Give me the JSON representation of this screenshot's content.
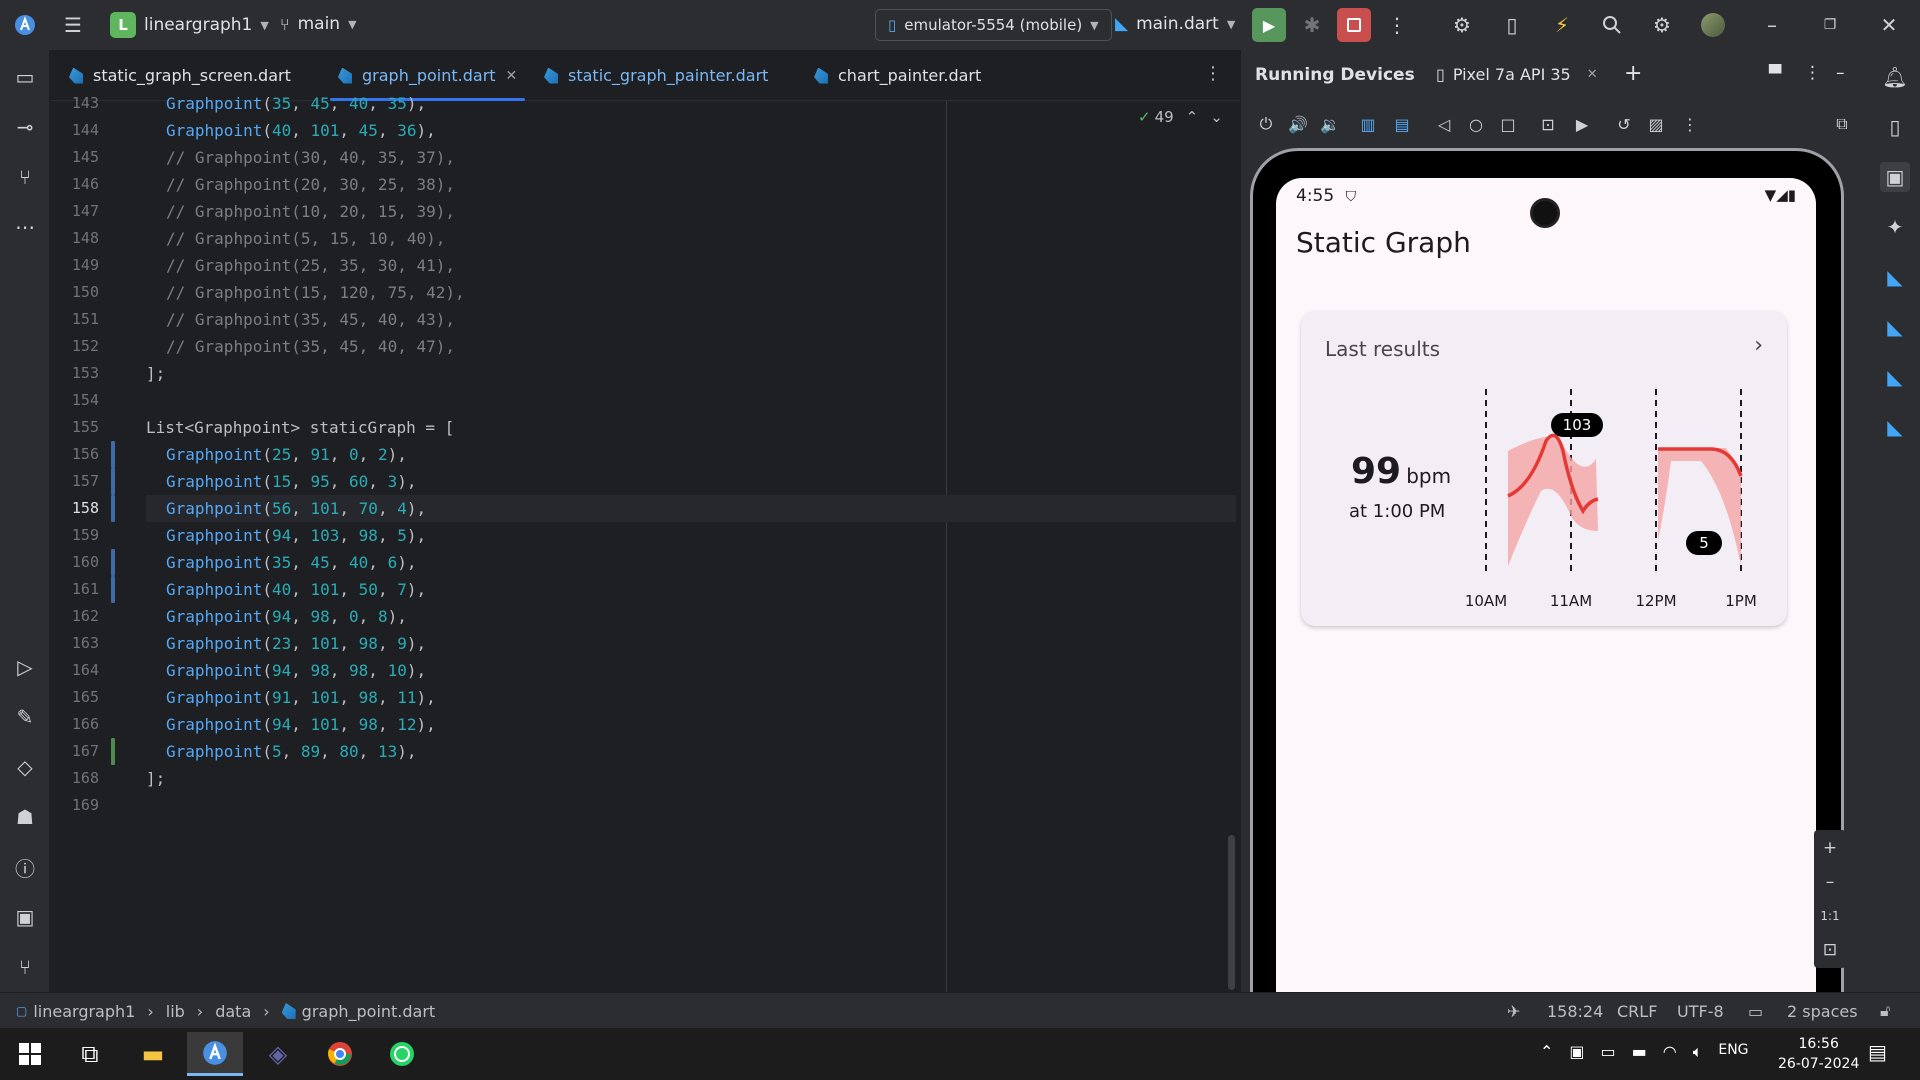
{
  "titlebar": {
    "project": "lineargraph1",
    "project_initial": "L",
    "branch": "main",
    "device": "emulator-5554 (mobile)",
    "run_config": "main.dart"
  },
  "tabs": [
    {
      "label": "static_graph_screen.dart",
      "active": false
    },
    {
      "label": "graph_point.dart",
      "active": true
    },
    {
      "label": "static_graph_painter.dart",
      "active": false
    },
    {
      "label": "chart_painter.dart",
      "active": false
    }
  ],
  "editor": {
    "inspection_count": "49",
    "lines": [
      {
        "n": "143",
        "code": [
          [
            "fn",
            "Graphpoint"
          ],
          [
            "pun",
            "("
          ],
          [
            "num",
            "35"
          ],
          [
            "pun",
            ", "
          ],
          [
            "num",
            "45"
          ],
          [
            "pun",
            ", "
          ],
          [
            "num",
            "40"
          ],
          [
            "pun",
            ", "
          ],
          [
            "num",
            "35"
          ],
          [
            "pun",
            "),"
          ]
        ]
      },
      {
        "n": "144",
        "code": [
          [
            "fn",
            "Graphpoint"
          ],
          [
            "pun",
            "("
          ],
          [
            "num",
            "40"
          ],
          [
            "pun",
            ", "
          ],
          [
            "num",
            "101"
          ],
          [
            "pun",
            ", "
          ],
          [
            "num",
            "45"
          ],
          [
            "pun",
            ", "
          ],
          [
            "num",
            "36"
          ],
          [
            "pun",
            "),"
          ]
        ]
      },
      {
        "n": "145",
        "comment": "Graphpoint(30, 40, 35, 37),"
      },
      {
        "n": "146",
        "comment": "Graphpoint(20, 30, 25, 38),"
      },
      {
        "n": "147",
        "comment": "Graphpoint(10, 20, 15, 39),"
      },
      {
        "n": "148",
        "comment": "Graphpoint(5, 15, 10, 40),"
      },
      {
        "n": "149",
        "comment": "Graphpoint(25, 35, 30, 41),"
      },
      {
        "n": "150",
        "comment": "Graphpoint(15, 120, 75, 42),"
      },
      {
        "n": "151",
        "comment": "Graphpoint(35, 45, 40, 43),"
      },
      {
        "n": "152",
        "comment": "Graphpoint(35, 45, 40, 47),"
      },
      {
        "n": "153",
        "plain": "];"
      },
      {
        "n": "154",
        "plain": ""
      },
      {
        "n": "155",
        "plain": "List<Graphpoint> staticGraph = ["
      },
      {
        "n": "156",
        "code": [
          [
            "fn",
            "Graphpoint"
          ],
          [
            "pun",
            "("
          ],
          [
            "num",
            "25"
          ],
          [
            "pun",
            ", "
          ],
          [
            "num",
            "91"
          ],
          [
            "pun",
            ", "
          ],
          [
            "num",
            "0"
          ],
          [
            "pun",
            ", "
          ],
          [
            "num",
            "2"
          ],
          [
            "pun",
            "),"
          ]
        ]
      },
      {
        "n": "157",
        "code": [
          [
            "fn",
            "Graphpoint"
          ],
          [
            "pun",
            "("
          ],
          [
            "num",
            "15"
          ],
          [
            "pun",
            ", "
          ],
          [
            "num",
            "95"
          ],
          [
            "pun",
            ", "
          ],
          [
            "num",
            "60"
          ],
          [
            "pun",
            ", "
          ],
          [
            "num",
            "3"
          ],
          [
            "pun",
            "),"
          ]
        ]
      },
      {
        "n": "158",
        "code": [
          [
            "fn",
            "Graphpoint"
          ],
          [
            "pun",
            "("
          ],
          [
            "num",
            "56"
          ],
          [
            "pun",
            ", "
          ],
          [
            "num",
            "101"
          ],
          [
            "pun",
            ", "
          ],
          [
            "num",
            "70"
          ],
          [
            "pun",
            ", "
          ],
          [
            "num",
            "4"
          ],
          [
            "pun",
            "),"
          ]
        ]
      },
      {
        "n": "159",
        "code": [
          [
            "fn",
            "Graphpoint"
          ],
          [
            "pun",
            "("
          ],
          [
            "num",
            "94"
          ],
          [
            "pun",
            ", "
          ],
          [
            "num",
            "103"
          ],
          [
            "pun",
            ", "
          ],
          [
            "num",
            "98"
          ],
          [
            "pun",
            ", "
          ],
          [
            "num",
            "5"
          ],
          [
            "pun",
            "),"
          ]
        ]
      },
      {
        "n": "160",
        "code": [
          [
            "fn",
            "Graphpoint"
          ],
          [
            "pun",
            "("
          ],
          [
            "num",
            "35"
          ],
          [
            "pun",
            ", "
          ],
          [
            "num",
            "45"
          ],
          [
            "pun",
            ", "
          ],
          [
            "num",
            "40"
          ],
          [
            "pun",
            ", "
          ],
          [
            "num",
            "6"
          ],
          [
            "pun",
            "),"
          ]
        ]
      },
      {
        "n": "161",
        "code": [
          [
            "fn",
            "Graphpoint"
          ],
          [
            "pun",
            "("
          ],
          [
            "num",
            "40"
          ],
          [
            "pun",
            ", "
          ],
          [
            "num",
            "101"
          ],
          [
            "pun",
            ", "
          ],
          [
            "num",
            "50"
          ],
          [
            "pun",
            ", "
          ],
          [
            "num",
            "7"
          ],
          [
            "pun",
            "),"
          ]
        ]
      },
      {
        "n": "162",
        "code": [
          [
            "fn",
            "Graphpoint"
          ],
          [
            "pun",
            "("
          ],
          [
            "num",
            "94"
          ],
          [
            "pun",
            ", "
          ],
          [
            "num",
            "98"
          ],
          [
            "pun",
            ", "
          ],
          [
            "num",
            "0"
          ],
          [
            "pun",
            ", "
          ],
          [
            "num",
            "8"
          ],
          [
            "pun",
            "),"
          ]
        ]
      },
      {
        "n": "163",
        "code": [
          [
            "fn",
            "Graphpoint"
          ],
          [
            "pun",
            "("
          ],
          [
            "num",
            "23"
          ],
          [
            "pun",
            ", "
          ],
          [
            "num",
            "101"
          ],
          [
            "pun",
            ", "
          ],
          [
            "num",
            "98"
          ],
          [
            "pun",
            ", "
          ],
          [
            "num",
            "9"
          ],
          [
            "pun",
            "),"
          ]
        ]
      },
      {
        "n": "164",
        "code": [
          [
            "fn",
            "Graphpoint"
          ],
          [
            "pun",
            "("
          ],
          [
            "num",
            "94"
          ],
          [
            "pun",
            ", "
          ],
          [
            "num",
            "98"
          ],
          [
            "pun",
            ", "
          ],
          [
            "num",
            "98"
          ],
          [
            "pun",
            ", "
          ],
          [
            "num",
            "10"
          ],
          [
            "pun",
            "),"
          ]
        ]
      },
      {
        "n": "165",
        "code": [
          [
            "fn",
            "Graphpoint"
          ],
          [
            "pun",
            "("
          ],
          [
            "num",
            "91"
          ],
          [
            "pun",
            ", "
          ],
          [
            "num",
            "101"
          ],
          [
            "pun",
            ", "
          ],
          [
            "num",
            "98"
          ],
          [
            "pun",
            ", "
          ],
          [
            "num",
            "11"
          ],
          [
            "pun",
            "),"
          ]
        ]
      },
      {
        "n": "166",
        "code": [
          [
            "fn",
            "Graphpoint"
          ],
          [
            "pun",
            "("
          ],
          [
            "num",
            "94"
          ],
          [
            "pun",
            ", "
          ],
          [
            "num",
            "101"
          ],
          [
            "pun",
            ", "
          ],
          [
            "num",
            "98"
          ],
          [
            "pun",
            ", "
          ],
          [
            "num",
            "12"
          ],
          [
            "pun",
            "),"
          ]
        ]
      },
      {
        "n": "167",
        "code": [
          [
            "fn",
            "Graphpoint"
          ],
          [
            "pun",
            "("
          ],
          [
            "num",
            "5"
          ],
          [
            "pun",
            ", "
          ],
          [
            "num",
            "89"
          ],
          [
            "pun",
            ", "
          ],
          [
            "num",
            "80"
          ],
          [
            "pun",
            ", "
          ],
          [
            "num",
            "13"
          ],
          [
            "pun",
            "),"
          ]
        ]
      },
      {
        "n": "168",
        "plain": "];"
      },
      {
        "n": "169",
        "plain": ""
      }
    ],
    "current_line": "158"
  },
  "running_devices": {
    "title": "Running Devices",
    "device_tab": "Pixel 7a API 35"
  },
  "phone": {
    "time": "4:55",
    "app_title": "Static Graph",
    "card_title": "Last results",
    "bpm_value": "99",
    "bpm_unit": "bpm",
    "bpm_time": "at 1:00 PM",
    "chart_labels": {
      "max": "103",
      "min": "5"
    }
  },
  "chart_data": {
    "type": "area",
    "title": "",
    "x": [
      "10AM",
      "11AM",
      "12PM",
      "1PM"
    ],
    "tooltips": [
      "103",
      "5"
    ],
    "color_line": "#e53935",
    "color_band": "#f4a5a5"
  },
  "zoom": {
    "fit": "1:1"
  },
  "statusbar": {
    "breadcrumb": [
      "lineargraph1",
      "lib",
      "data",
      "graph_point.dart"
    ],
    "position": "158:24",
    "line_sep": "CRLF",
    "encoding": "UTF-8",
    "indent": "2 spaces"
  },
  "taskbar": {
    "lang": "ENG",
    "time": "16:56",
    "date": "26-07-2024"
  }
}
